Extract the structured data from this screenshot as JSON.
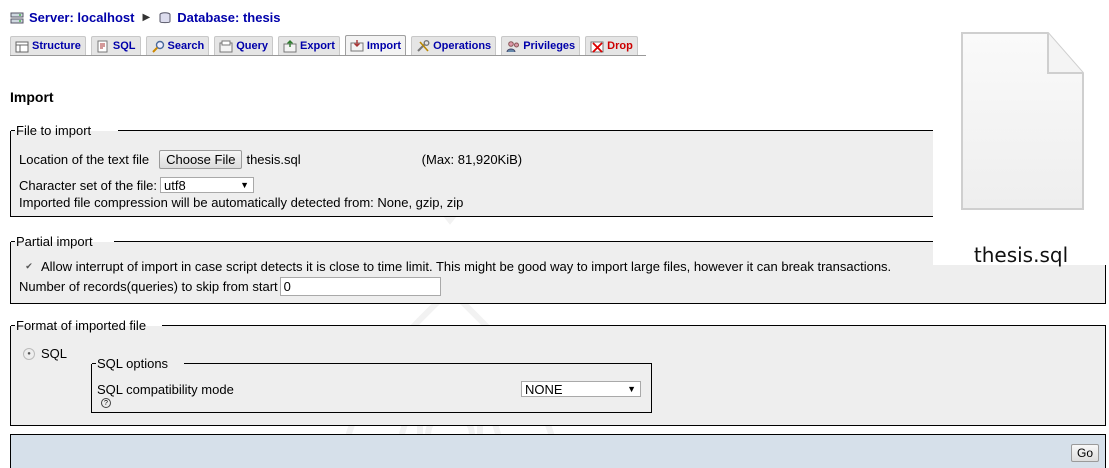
{
  "breadcrumb": {
    "server": "Server: localhost",
    "database": "Database: thesis"
  },
  "tabs": [
    {
      "label": "Structure",
      "icon": "structure-icon"
    },
    {
      "label": "SQL",
      "icon": "sql-icon"
    },
    {
      "label": "Search",
      "icon": "search-icon"
    },
    {
      "label": "Query",
      "icon": "query-icon"
    },
    {
      "label": "Export",
      "icon": "export-icon"
    },
    {
      "label": "Import",
      "icon": "import-icon",
      "active": true
    },
    {
      "label": "Operations",
      "icon": "operations-icon"
    },
    {
      "label": "Privileges",
      "icon": "privileges-icon"
    },
    {
      "label": "Drop",
      "icon": "drop-icon"
    }
  ],
  "page_title": "Import",
  "file_to_import": {
    "legend": "File to import",
    "location_label": "Location of the text file",
    "choose_button": "Choose File",
    "file_name": "thesis.sql",
    "max_size": "(Max: 81,920KiB)",
    "charset_label": "Character set of the file:",
    "charset_value": "utf8",
    "compression_note": "Imported file compression will be automatically detected from: None, gzip, zip"
  },
  "partial_import": {
    "legend": "Partial import",
    "allow_interrupt_label": "Allow interrupt of import in case script detects it is close to time limit. This might be good way to import large files, however it can break transactions.",
    "allow_interrupt_checked": true,
    "skip_label": "Number of records(queries) to skip from start",
    "skip_value": "0"
  },
  "format": {
    "legend": "Format of imported file",
    "sql_radio_label": "SQL",
    "sql_options_legend": "SQL options",
    "compat_label": "SQL compatibility mode",
    "compat_value": "NONE"
  },
  "go_button": "Go",
  "file_preview": {
    "name": "thesis.sql"
  },
  "colors": {
    "link": "#0000aa",
    "fieldset_bg": "#eeeeee",
    "go_bar_bg": "#d6e0ea",
    "drop": "#cc0000"
  }
}
